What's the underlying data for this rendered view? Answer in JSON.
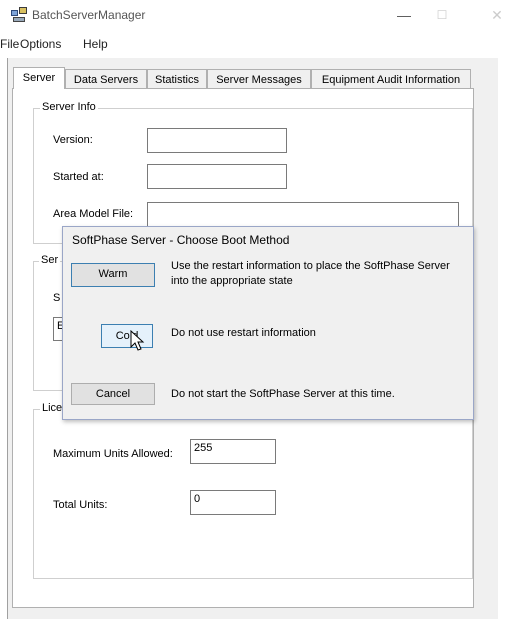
{
  "window": {
    "title": "BatchServerManager",
    "minimize_glyph": "—",
    "maximize_glyph": "☐",
    "close_glyph": "✕"
  },
  "menu": [
    "File",
    "Options",
    "Help"
  ],
  "tabs": [
    "Server",
    "Data Servers",
    "Statistics",
    "Server Messages",
    "Equipment Audit Information"
  ],
  "server_info": {
    "legend": "Server Info",
    "version_label": "Version:",
    "version_value": "",
    "started_label": "Started at:",
    "started_value": "",
    "area_model_label": "Area Model File:",
    "area_model_value": ""
  },
  "partial_group": {
    "legend_fragment": "Ser",
    "label_fragment": "S",
    "field_fragment": "E"
  },
  "license_info": {
    "legend": "License Info",
    "max_units_label": "Maximum Units Allowed:",
    "max_units_value": "255",
    "total_units_label": "Total Units:",
    "total_units_value": "0"
  },
  "dialog": {
    "title": "SoftPhase Server - Choose Boot Method",
    "warm_label": "Warm",
    "warm_desc": "Use the restart information to place the SoftPhase Server into the appropriate state",
    "cold_label": "Cold",
    "cold_desc": "Do not use restart information",
    "cancel_label": "Cancel",
    "cancel_desc": "Do not start the SoftPhase Server at this time."
  },
  "colors": {
    "focus_border": "#3c7fb1",
    "dialog_border": "#9aa6c7",
    "panel_bg": "#f0f0f0"
  }
}
